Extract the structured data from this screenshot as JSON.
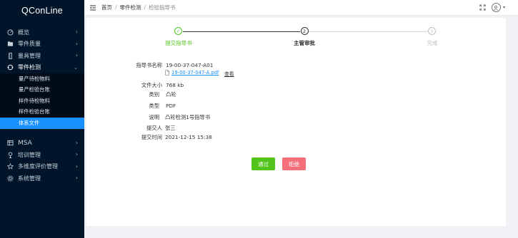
{
  "app": {
    "title": "QConLine"
  },
  "sidebar": {
    "items": [
      {
        "label": "概览",
        "icon": "dashboard-icon"
      },
      {
        "label": "零件质量",
        "icon": "folder-icon"
      },
      {
        "label": "量具管理",
        "icon": "gauge-icon"
      },
      {
        "label": "零件检测",
        "icon": "inspection-icon",
        "open": true
      },
      {
        "label": "MSA",
        "icon": "table-icon"
      },
      {
        "label": "培训管理",
        "icon": "training-icon"
      },
      {
        "label": "多维度评价管理",
        "icon": "star-icon"
      },
      {
        "label": "系统管理",
        "icon": "settings-icon"
      }
    ],
    "submenu": [
      {
        "label": "量产待检物料"
      },
      {
        "label": "量产检验台账"
      },
      {
        "label": "样件待检物料"
      },
      {
        "label": "样件检验台账"
      },
      {
        "label": "体系文件",
        "active": true
      }
    ]
  },
  "header": {
    "breadcrumb": [
      "首页",
      "零件检测",
      "检验指导书"
    ],
    "separator": "/"
  },
  "steps": [
    {
      "number": "✓",
      "label": "提交指导书",
      "status": "finished"
    },
    {
      "number": "2",
      "label": "主管审批",
      "status": "process"
    },
    {
      "number": "3",
      "label": "完成",
      "status": "wait"
    }
  ],
  "detail": {
    "fields": [
      {
        "key": "指导书名称",
        "value": "19-00-37-047-A01"
      },
      {
        "key": "",
        "file_name": "19-00-37-047-A.pdf",
        "action": "查看"
      },
      {
        "key": "文件大小",
        "value": "768 kb"
      },
      {
        "key": "类别",
        "value": "凸轮"
      },
      {
        "key": "类型",
        "value": "PDF"
      },
      {
        "key": "说明",
        "value": "凸轮检测1号指导书"
      },
      {
        "key": "提交人",
        "value": "张三"
      },
      {
        "key": "提交时间",
        "value": "2021-12-15 15:38"
      }
    ]
  },
  "actions": {
    "approve": "通过",
    "reject": "拒绝"
  },
  "colors": {
    "sidebar_bg": "#001529",
    "active": "#1890ff",
    "success": "#52c41a",
    "danger": "#f5707a"
  }
}
